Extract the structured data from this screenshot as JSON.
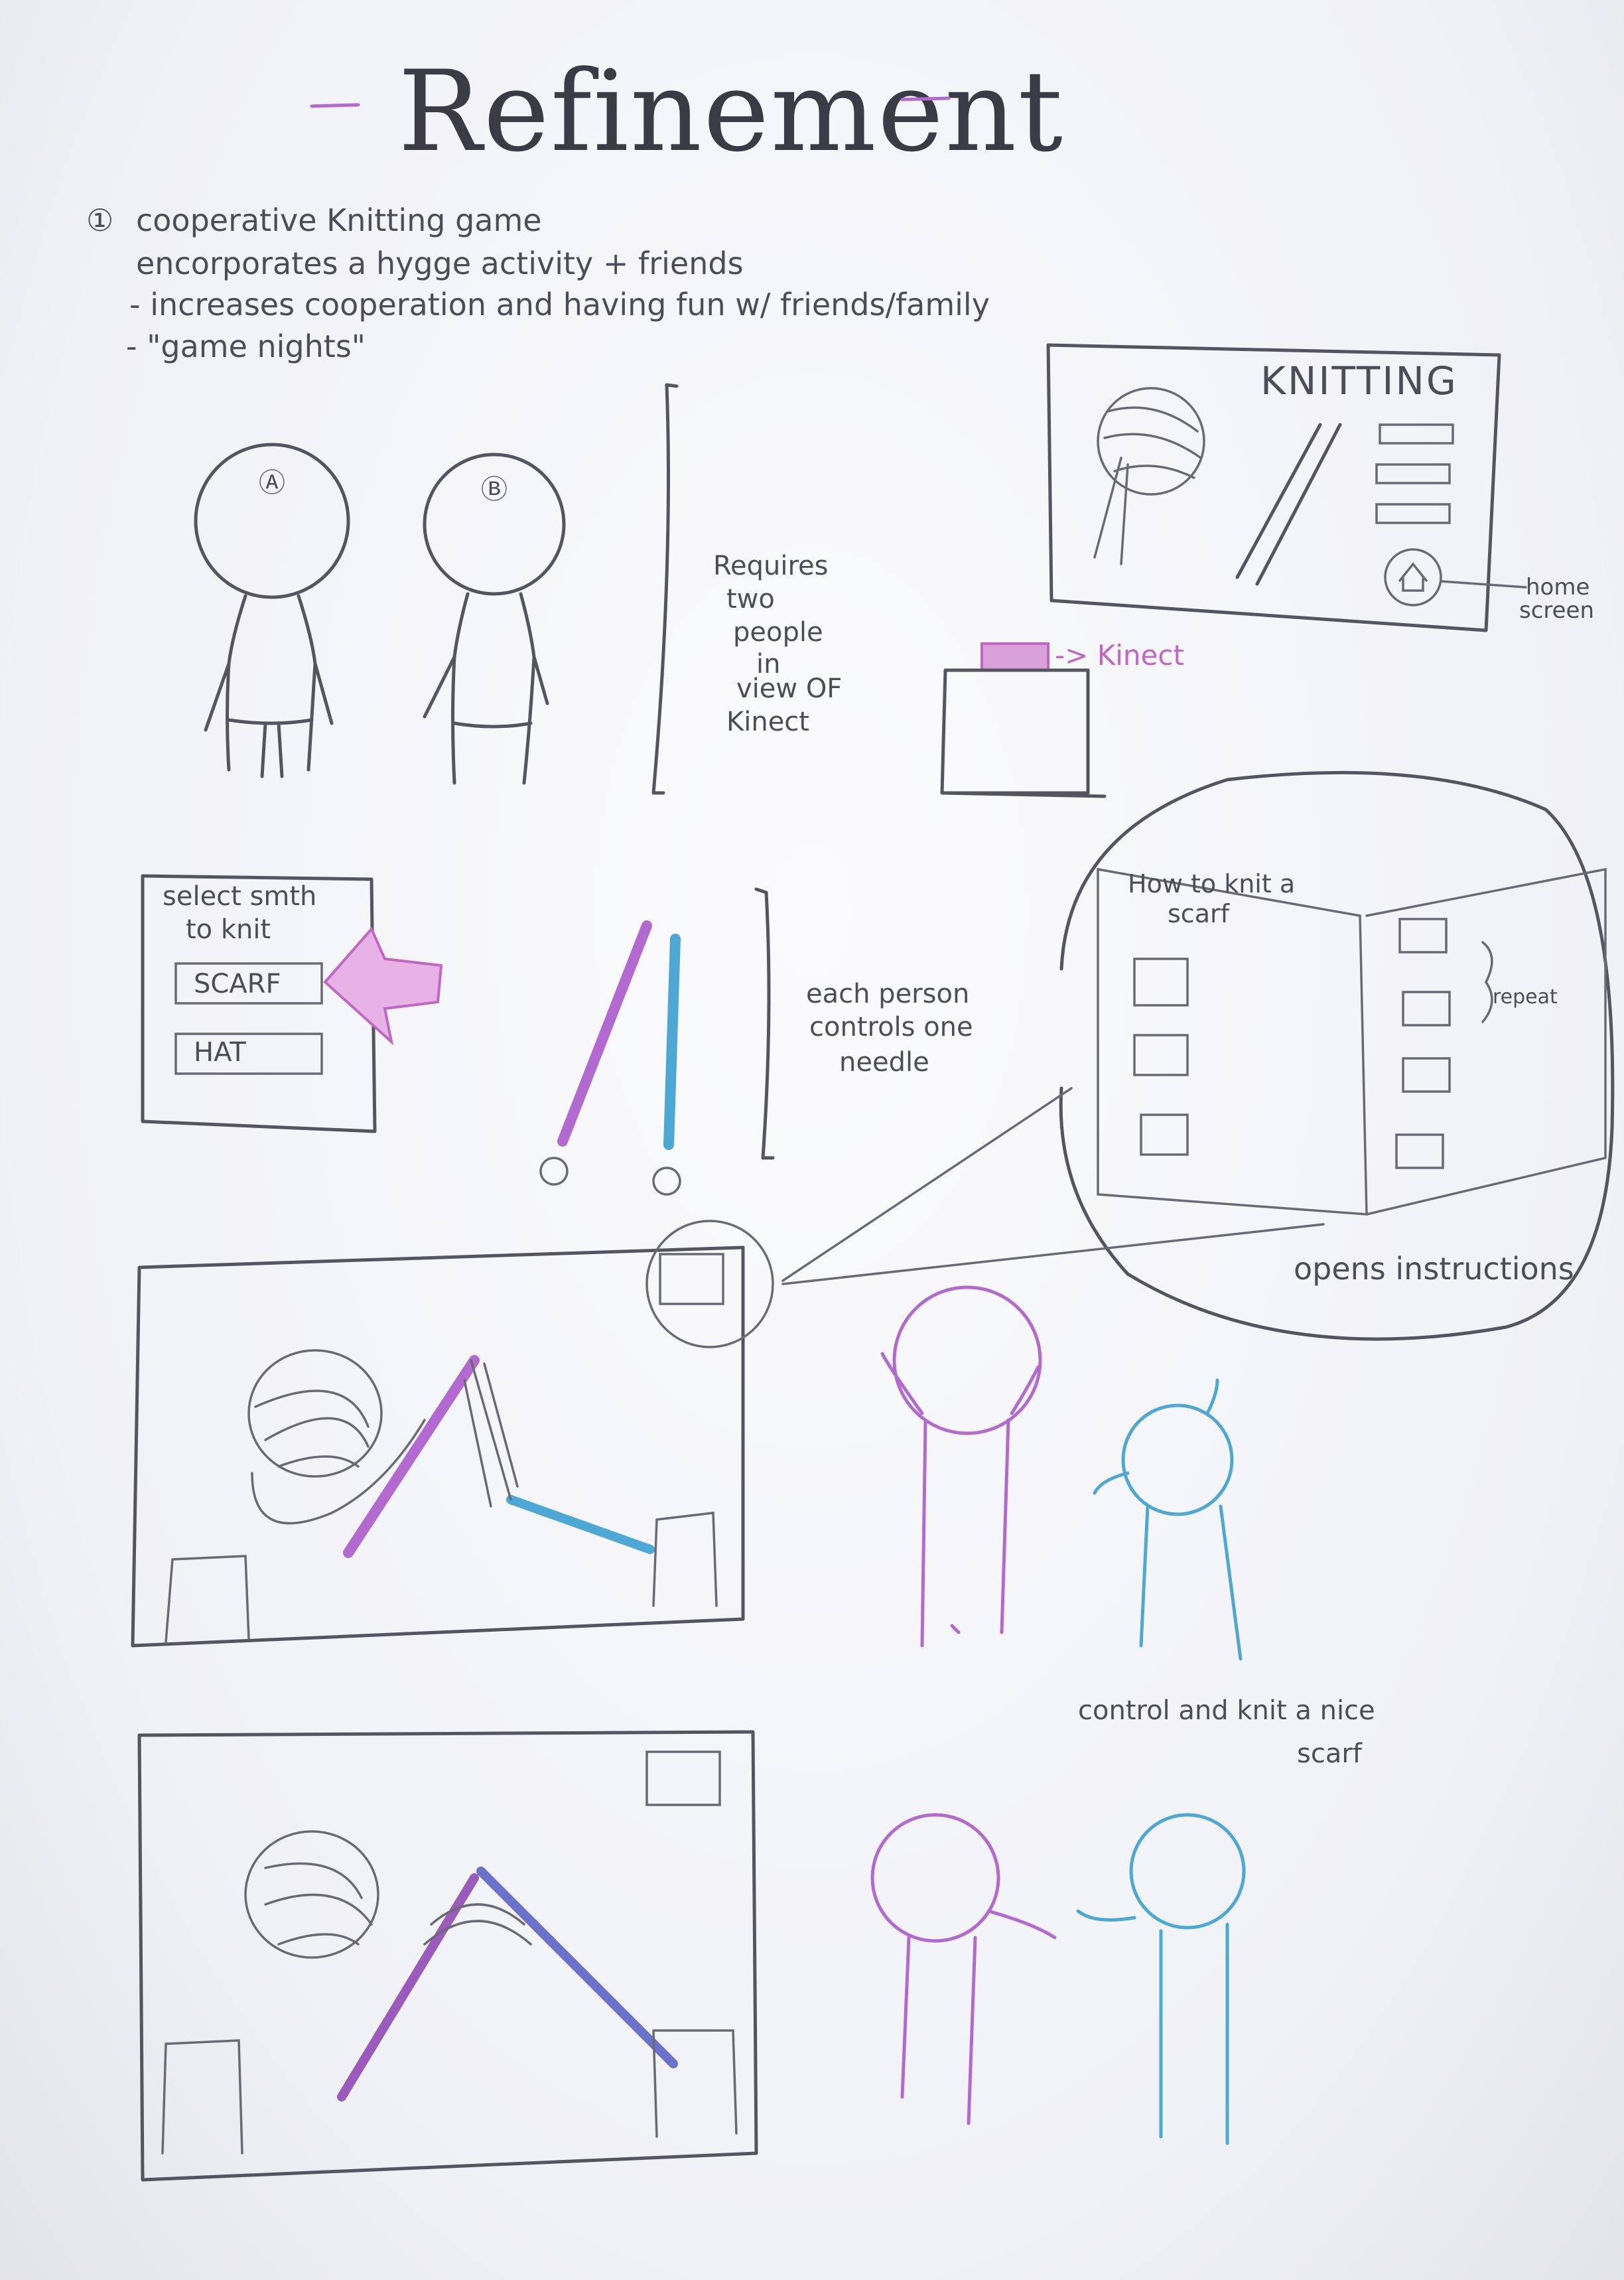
{
  "page": {
    "title": "Refinement",
    "intro": {
      "number": "①",
      "line1": "cooperative Knitting game",
      "line2": "encorporates a hygge activity + friends",
      "line3": "- increases cooperation and having fun w/ friends/family",
      "line4": "- \"game nights\""
    },
    "players": {
      "a": "Ⓐ",
      "b": "Ⓑ"
    },
    "requires_note": [
      "Requires",
      "two",
      "people",
      "in",
      "view OF",
      "Kinect"
    ],
    "home_screen": {
      "title": "KNITTING",
      "home_label_1": "home",
      "home_label_2": "screen"
    },
    "kinect_label": "-> Kinect",
    "select_menu": {
      "heading_1": "select smth",
      "heading_2": "to knit",
      "options": [
        "SCARF",
        "HAT"
      ]
    },
    "needle_note": [
      "each person",
      "controls one",
      "needle"
    ],
    "instructions_book": {
      "title_1": "How to knit a",
      "title_2": "scarf",
      "repeat_label": "repeat",
      "caption": "opens instructions"
    },
    "control_caption_1": "control and knit a nice",
    "control_caption_2": "scarf",
    "colors": {
      "pencil": "#55555f",
      "purple": "#b26ad1",
      "blue": "#4ea8d6",
      "pink": "#c266c4"
    }
  }
}
